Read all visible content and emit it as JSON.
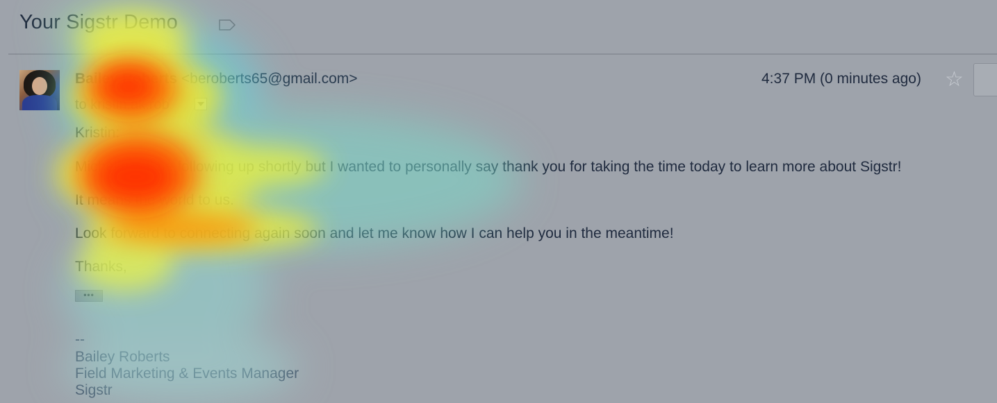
{
  "email": {
    "subject": "Your Sigstr Demo",
    "sender": {
      "name": "Bailey Roberts",
      "email": "<beroberts65@gmail.com>"
    },
    "timestamp": "4:37 PM (0 minutes ago)",
    "recipient": {
      "prefix": "to",
      "name": "kristin.ak.rob"
    },
    "body": {
      "greeting": "Kristin:",
      "paragraph_1": "Michelle will be following up shortly but I wanted to personally say thank you for taking the time today to learn more about Sigstr!",
      "paragraph_2": "It means the world to us.",
      "paragraph_3": "Look forward to connecting again soon and let me know how I can help you in the meantime!",
      "closing": "Thanks,",
      "trimmed_content_label": "•••"
    },
    "signature": {
      "separator": "--",
      "name": "Bailey Roberts",
      "title": "Field Marketing & Events Manager",
      "company": "Sigstr"
    }
  },
  "icons": {
    "label": "label-icon",
    "star": "star-icon",
    "recipient_details": "chevron-down-icon",
    "avatar": "avatar"
  },
  "colors": {
    "background": "#9ea3ab",
    "text": "#1f2a3e",
    "heat_hot": "#ff2a00",
    "heat_warm": "#ffee00",
    "heat_cool": "#3fd0c0"
  }
}
